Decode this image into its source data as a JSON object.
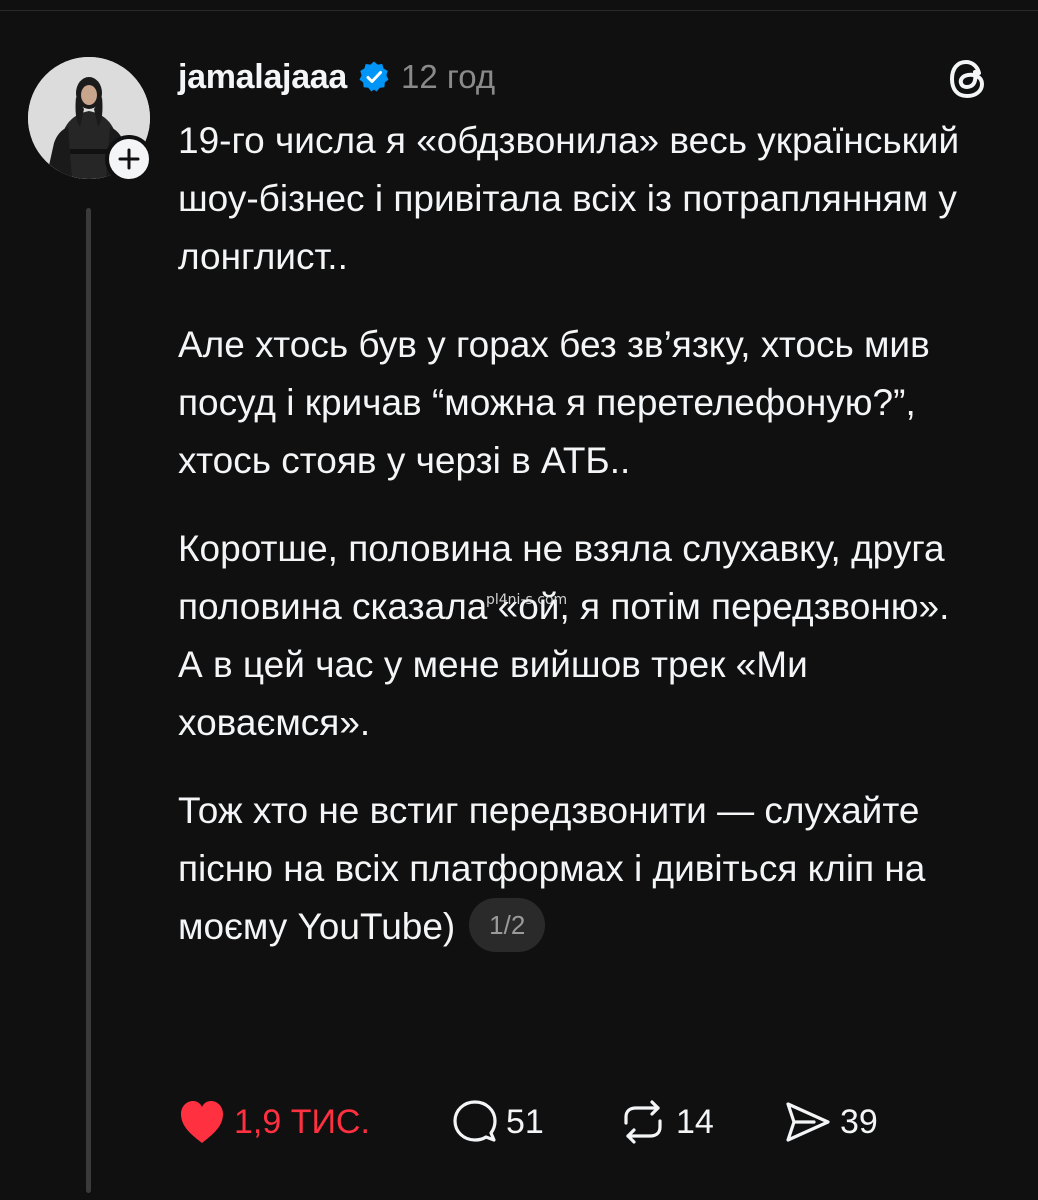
{
  "post": {
    "username": "jamalajaaa",
    "timestamp": "12 год",
    "paragraphs": [
      "19-го числа я «обдзвонила» весь український шоу-бізнес і привітала всіх із потраплянням у лонглист..",
      "Але хтось був у горах без зв’язку, хтось мив посуд і кричав “можна я перетелефоную?”, хтось стояв у черзі в АТБ..",
      "Коротше, половина не взяла слухавку, друга половина сказала «ой, я потім передзвоню».",
      "А в цей час у мене вийшов трек «Ми ховаємся».",
      "Тож хто не встиг передзвонити — слухайте пісню на всіх платформах і дивіться кліп на моєму YouTube)"
    ],
    "page_indicator": "1/2",
    "watermark": "pl4ni-s.com"
  },
  "actions": {
    "likes": "1,9 ТИС.",
    "comments": "51",
    "reposts": "14",
    "shares": "39"
  },
  "colors": {
    "background": "#101010",
    "text": "#f3f5f7",
    "muted": "#8a8a8a",
    "like": "#ff3040",
    "verified": "#0095f6"
  },
  "icons": [
    "avatar",
    "plus-icon",
    "verified-badge-icon",
    "threads-logo-icon",
    "heart-icon",
    "comment-icon",
    "repost-icon",
    "share-icon"
  ]
}
